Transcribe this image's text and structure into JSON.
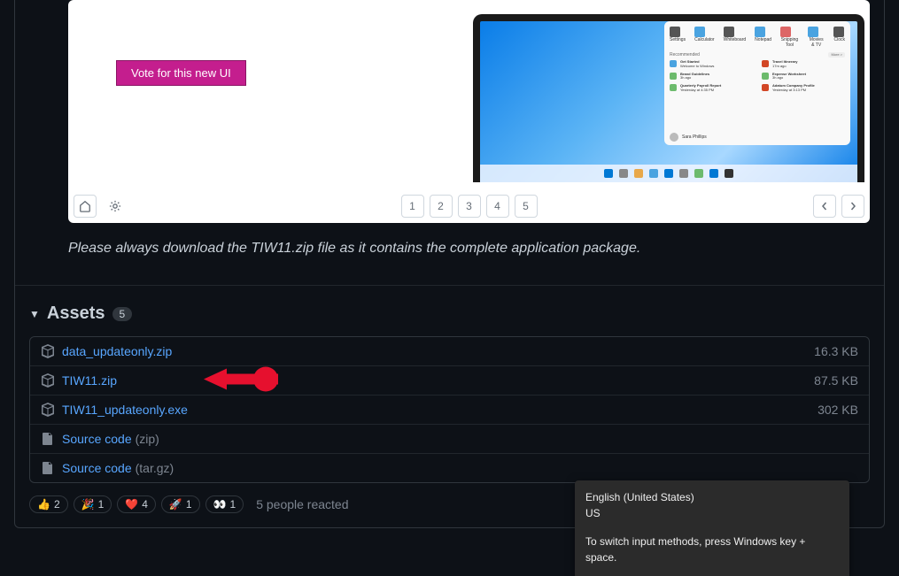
{
  "slideshow": {
    "vote_label": "Vote for this new UI",
    "pages": [
      "1",
      "2",
      "3",
      "4",
      "5"
    ],
    "start_menu": {
      "recommended_label": "Recommended",
      "more_label": "More >",
      "user_name": "Sara Phillips",
      "pinned": [
        {
          "label": "Settings"
        },
        {
          "label": "Calculator"
        },
        {
          "label": "Whiteboard"
        },
        {
          "label": "Notepad"
        },
        {
          "label": "Snipping Tool"
        },
        {
          "label": "Movies & TV"
        },
        {
          "label": "Clock"
        }
      ],
      "recs_left": [
        {
          "title": "Get Started",
          "sub": "Welcome to Windows"
        },
        {
          "title": "Brand Guidelines",
          "sub": "3h ago"
        },
        {
          "title": "Quarterly Payroll Report",
          "sub": "Yesterday at 4:35 PM"
        }
      ],
      "recs_right": [
        {
          "title": "Travel Itinerary",
          "sub": "17m ago"
        },
        {
          "title": "Expense Worksheet",
          "sub": "3h ago"
        },
        {
          "title": "Adatum Company Profile",
          "sub": "Yesterday at 3:13 PM"
        }
      ]
    }
  },
  "notice_text": "Please always download the TIW11.zip file as it contains the complete application package.",
  "assets": {
    "title": "Assets",
    "count": "5",
    "items": [
      {
        "name": "data_updateonly.zip",
        "ext": "",
        "size": "16.3 KB",
        "icon": "package"
      },
      {
        "name": "TIW11.zip",
        "ext": "",
        "size": "87.5 KB",
        "icon": "package",
        "highlight": true
      },
      {
        "name": "TIW11_updateonly.exe",
        "ext": "",
        "size": "302 KB",
        "icon": "package"
      },
      {
        "name": "Source code",
        "ext": "(zip)",
        "size": "",
        "icon": "zip"
      },
      {
        "name": "Source code",
        "ext": "(tar.gz)",
        "size": "",
        "icon": "zip"
      }
    ]
  },
  "reactions": {
    "items": [
      {
        "emoji": "👍",
        "count": "2"
      },
      {
        "emoji": "🎉",
        "count": "1"
      },
      {
        "emoji": "❤️",
        "count": "4"
      },
      {
        "emoji": "🚀",
        "count": "1"
      },
      {
        "emoji": "👀",
        "count": "1"
      }
    ],
    "summary": "5 people reacted"
  },
  "ime": {
    "language": "English (United States)",
    "region": "US",
    "hint": "To switch input methods, press Windows key + space."
  }
}
